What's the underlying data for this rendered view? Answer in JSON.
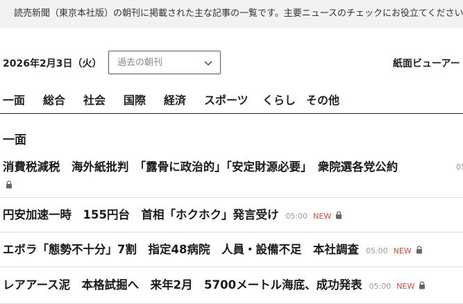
{
  "notice": "読売新聞（東京本社版）の朝刊に掲載された主な記事の一覧です。主要ニュースのチェックにお役立てください。",
  "date": "2026年2月3日（火）",
  "select": {
    "label": "過去の朝刊"
  },
  "viewer_link": "紙面ビューアー",
  "tabs": [
    {
      "label": "一面"
    },
    {
      "label": "総合"
    },
    {
      "label": "社会"
    },
    {
      "label": "国際"
    },
    {
      "label": "経済"
    },
    {
      "label": "スポーツ"
    },
    {
      "label": "くらし"
    },
    {
      "label": "その他"
    }
  ],
  "section_title": "一面",
  "articles": [
    {
      "title": "消費税減税　海外紙批判　「露骨に政治的」「安定財源必要」　衆院選各党公約",
      "time": "05",
      "new": "",
      "locked": true
    },
    {
      "title": "円安加速一時　155円台　首相「ホクホク」発言受け",
      "time": "05:00",
      "new": "NEW",
      "locked": true
    },
    {
      "title": "エボラ「態勢不十分」7割　指定48病院　人員・設備不足　本社調査",
      "time": "05:00",
      "new": "NEW",
      "locked": true
    },
    {
      "title": "レアアース泥　本格試掘へ　来年2月　5700メートル海底、成功発表",
      "time": "05:00",
      "new": "NEW",
      "locked": true
    }
  ]
}
